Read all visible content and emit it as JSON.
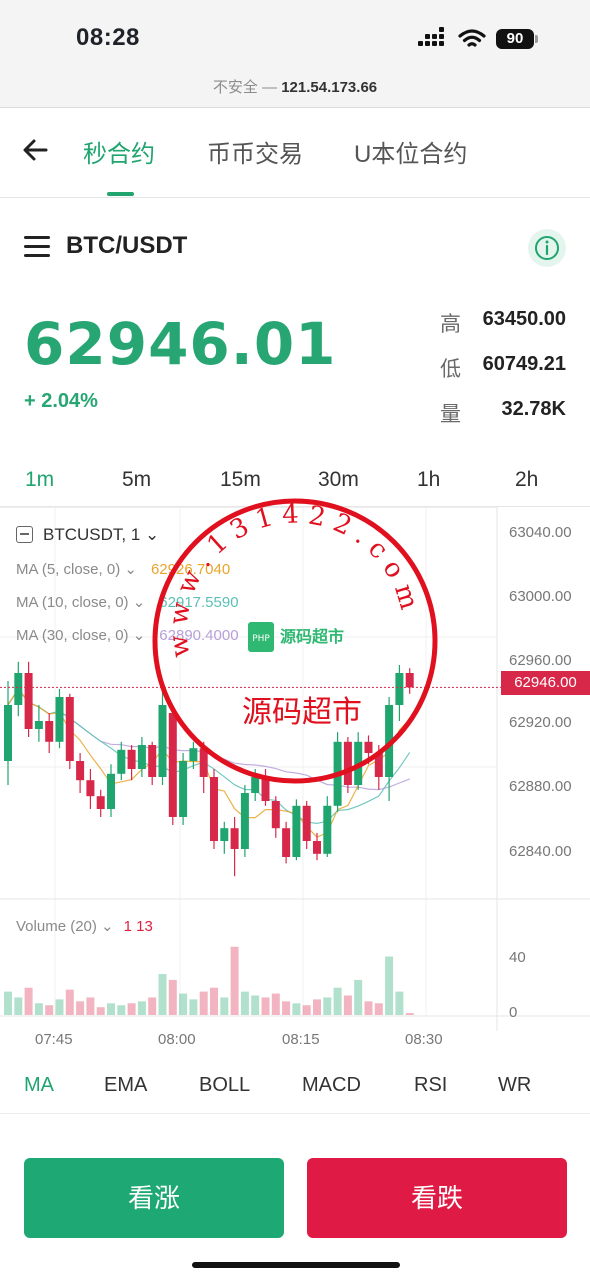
{
  "status": {
    "time": "08:28",
    "battery": "90",
    "url_prefix": "不安全 — ",
    "url_host": "121.54.173.66"
  },
  "nav": {
    "tabs": [
      "秒合约",
      "币币交易",
      "U本位合约"
    ]
  },
  "pair": {
    "name": "BTC/USDT"
  },
  "ticker": {
    "price": "62946.01",
    "change": "+ 2.04%",
    "high_label": "高",
    "high": "63450.00",
    "low_label": "低",
    "low": "60749.21",
    "vol_label": "量",
    "vol": "32.78K"
  },
  "intervals": [
    "1m",
    "5m",
    "15m",
    "30m",
    "1h",
    "2h"
  ],
  "chart": {
    "symbol": "BTCUSDT, 1",
    "ma5_label": "MA (5, close, 0)",
    "ma5_value": "62926.7040",
    "ma10_label": "MA (10, close, 0)",
    "ma10_value": "62917.5590",
    "ma30_label": "MA (30, close, 0)",
    "ma30_value": "62890.4000",
    "volume_label": "Volume (20)",
    "volume_value": "1 13",
    "y_ticks": [
      "63040.00",
      "63000.00",
      "62960.00",
      "62920.00",
      "62880.00",
      "62840.00"
    ],
    "last_price_tag": "62946.00",
    "vol_ticks": [
      "40",
      "0"
    ],
    "x_ticks": [
      "07:45",
      "08:00",
      "08:15",
      "08:30"
    ],
    "colors": {
      "up": "#20a56f",
      "down": "#d8284a",
      "ma5": "#e8a52a",
      "ma10": "#5bbfb6",
      "ma30": "#b79fd8"
    }
  },
  "chart_data": {
    "type": "candlestick",
    "x_ticks": [
      "07:45",
      "08:00",
      "08:15",
      "08:30"
    ],
    "ylim": [
      62820,
      63045
    ],
    "candles": [
      {
        "o": 62900,
        "c": 62935,
        "h": 62950,
        "l": 62885,
        "v": 12
      },
      {
        "o": 62935,
        "c": 62955,
        "h": 62962,
        "l": 62928,
        "v": 9
      },
      {
        "o": 62955,
        "c": 62920,
        "h": 62962,
        "l": 62915,
        "v": 14
      },
      {
        "o": 62920,
        "c": 62925,
        "h": 62935,
        "l": 62912,
        "v": 6
      },
      {
        "o": 62925,
        "c": 62912,
        "h": 62930,
        "l": 62905,
        "v": 5
      },
      {
        "o": 62912,
        "c": 62940,
        "h": 62945,
        "l": 62908,
        "v": 8
      },
      {
        "o": 62940,
        "c": 62900,
        "h": 62942,
        "l": 62895,
        "v": 13
      },
      {
        "o": 62900,
        "c": 62888,
        "h": 62905,
        "l": 62880,
        "v": 7
      },
      {
        "o": 62888,
        "c": 62878,
        "h": 62895,
        "l": 62870,
        "v": 9
      },
      {
        "o": 62878,
        "c": 62870,
        "h": 62882,
        "l": 62865,
        "v": 4
      },
      {
        "o": 62870,
        "c": 62892,
        "h": 62898,
        "l": 62865,
        "v": 6
      },
      {
        "o": 62892,
        "c": 62907,
        "h": 62912,
        "l": 62888,
        "v": 5
      },
      {
        "o": 62907,
        "c": 62895,
        "h": 62910,
        "l": 62888,
        "v": 6
      },
      {
        "o": 62895,
        "c": 62910,
        "h": 62915,
        "l": 62890,
        "v": 7
      },
      {
        "o": 62910,
        "c": 62890,
        "h": 62912,
        "l": 62885,
        "v": 9
      },
      {
        "o": 62890,
        "c": 62935,
        "h": 62945,
        "l": 62885,
        "v": 21
      },
      {
        "o": 62930,
        "c": 62865,
        "h": 62935,
        "l": 62860,
        "v": 18
      },
      {
        "o": 62865,
        "c": 62900,
        "h": 62905,
        "l": 62860,
        "v": 11
      },
      {
        "o": 62900,
        "c": 62908,
        "h": 62912,
        "l": 62895,
        "v": 8
      },
      {
        "o": 62908,
        "c": 62890,
        "h": 62912,
        "l": 62880,
        "v": 12
      },
      {
        "o": 62890,
        "c": 62850,
        "h": 62895,
        "l": 62845,
        "v": 14
      },
      {
        "o": 62850,
        "c": 62858,
        "h": 62862,
        "l": 62842,
        "v": 9
      },
      {
        "o": 62858,
        "c": 62845,
        "h": 62865,
        "l": 62828,
        "v": 35
      },
      {
        "o": 62845,
        "c": 62880,
        "h": 62885,
        "l": 62840,
        "v": 12
      },
      {
        "o": 62880,
        "c": 62890,
        "h": 62895,
        "l": 62875,
        "v": 10
      },
      {
        "o": 62890,
        "c": 62875,
        "h": 62895,
        "l": 62872,
        "v": 9
      },
      {
        "o": 62875,
        "c": 62858,
        "h": 62878,
        "l": 62852,
        "v": 11
      },
      {
        "o": 62858,
        "c": 62840,
        "h": 62862,
        "l": 62836,
        "v": 7
      },
      {
        "o": 62840,
        "c": 62872,
        "h": 62876,
        "l": 62838,
        "v": 6
      },
      {
        "o": 62872,
        "c": 62850,
        "h": 62875,
        "l": 62845,
        "v": 5
      },
      {
        "o": 62850,
        "c": 62842,
        "h": 62855,
        "l": 62838,
        "v": 8
      },
      {
        "o": 62842,
        "c": 62872,
        "h": 62878,
        "l": 62840,
        "v": 9
      },
      {
        "o": 62872,
        "c": 62912,
        "h": 62918,
        "l": 62868,
        "v": 14
      },
      {
        "o": 62912,
        "c": 62885,
        "h": 62915,
        "l": 62880,
        "v": 10
      },
      {
        "o": 62885,
        "c": 62912,
        "h": 62918,
        "l": 62882,
        "v": 18
      },
      {
        "o": 62912,
        "c": 62905,
        "h": 62916,
        "l": 62898,
        "v": 7
      },
      {
        "o": 62905,
        "c": 62890,
        "h": 62910,
        "l": 62882,
        "v": 6
      },
      {
        "o": 62890,
        "c": 62935,
        "h": 62940,
        "l": 62875,
        "v": 30
      },
      {
        "o": 62935,
        "c": 62955,
        "h": 62960,
        "l": 62925,
        "v": 12
      },
      {
        "o": 62955,
        "c": 62946,
        "h": 62958,
        "l": 62942,
        "v": 1
      }
    ]
  },
  "indicators": [
    "MA",
    "EMA",
    "BOLL",
    "MACD",
    "RSI",
    "WR"
  ],
  "actions": {
    "buy": "看涨",
    "sell": "看跌"
  },
  "watermark": {
    "ring_text": "w w w . 1 3 1 4 2 2 . c o m",
    "center_text": "源码超市",
    "logo_text": "源码超市",
    "logo_sub": "PHP"
  }
}
